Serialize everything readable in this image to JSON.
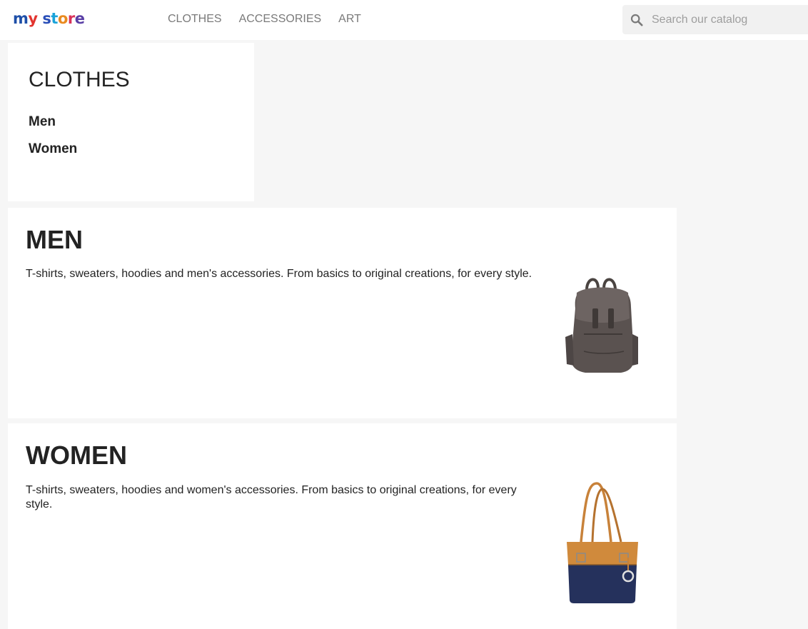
{
  "header": {
    "logo_text": "my store",
    "nav": [
      "CLOTHES",
      "ACCESSORIES",
      "ART"
    ],
    "search_placeholder": "Search our catalog",
    "search_value": ""
  },
  "sidebar": {
    "title": "CLOTHES",
    "links": [
      "Men",
      "Women"
    ]
  },
  "categories": [
    {
      "title": "MEN",
      "description": "T-shirts, sweaters, hoodies and men's accessories. From basics to original creations, for every style."
    },
    {
      "title": "WOMEN",
      "description": "T-shirts, sweaters, hoodies and women's accessories. From basics to original creations, for every style."
    }
  ],
  "colors": {
    "text": "#232323",
    "nav_text": "#7a7a7a",
    "page_background": "#f6f6f6",
    "panel_background": "#ffffff",
    "search_background": "#f1f1f1"
  },
  "icons": [
    "search-icon"
  ]
}
